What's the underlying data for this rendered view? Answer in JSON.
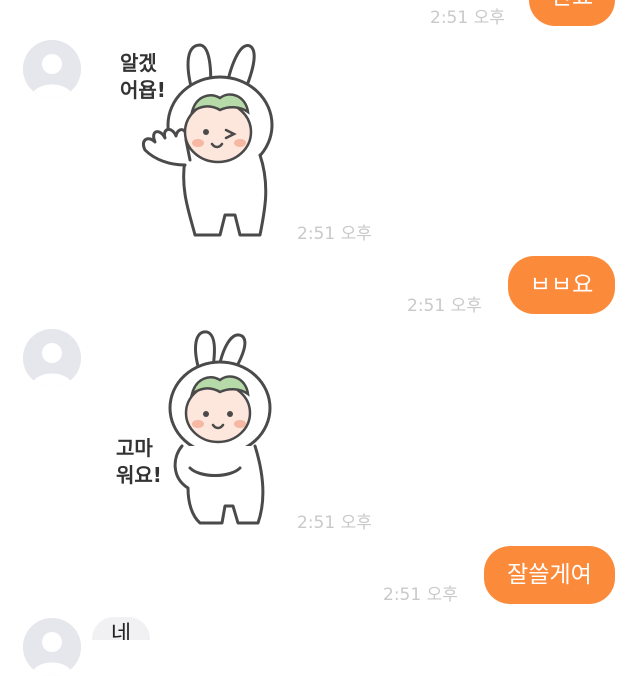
{
  "colors": {
    "outgoing_bubble": "#fc8a3b",
    "incoming_bubble": "#f1f1f3",
    "timestamp": "#c9c9c9"
  },
  "messages": [
    {
      "side": "out",
      "type": "text",
      "text": "안료",
      "time": "2:51 오후"
    },
    {
      "side": "in",
      "type": "sticker",
      "sticker_text": [
        "알겠",
        "어욥!"
      ],
      "icon": "bunny-ok-sticker",
      "time": "2:51 오후"
    },
    {
      "side": "out",
      "type": "text",
      "text": "ㅂㅂ요",
      "time": "2:51 오후"
    },
    {
      "side": "in",
      "type": "sticker",
      "sticker_text": [
        "고마",
        "워요!"
      ],
      "icon": "bunny-thanks-sticker",
      "time": "2:51 오후"
    },
    {
      "side": "out",
      "type": "text",
      "text": "잘쓸게여",
      "time": "2:51 오후"
    },
    {
      "side": "in",
      "type": "text",
      "text": "네"
    }
  ]
}
